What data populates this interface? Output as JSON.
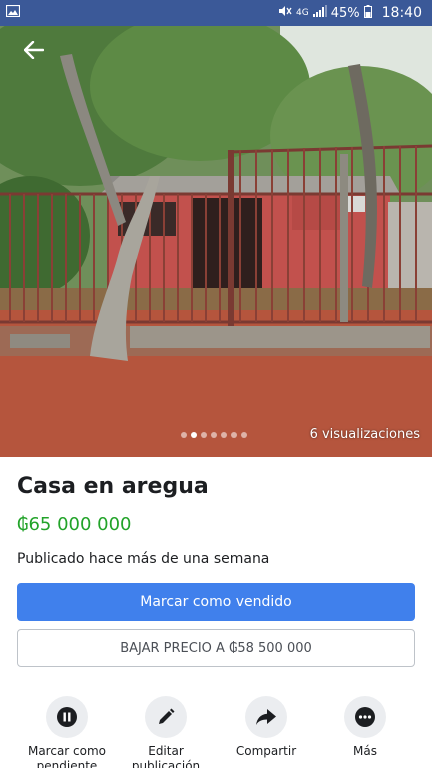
{
  "status_bar": {
    "signal_label": "4G",
    "battery": "45%",
    "time": "18:40"
  },
  "listing": {
    "image_views": "6 visualizaciones",
    "image_count": 7,
    "active_image_index": 1,
    "title": "Casa en aregua",
    "price": "₲65 000 000",
    "posted": "Publicado hace más de una semana"
  },
  "buttons": {
    "mark_sold": "Marcar como vendido",
    "lower_price": "BAJAR PRECIO A ₲58 500 000"
  },
  "actions": [
    {
      "label": "Marcar como pendiente",
      "icon": "pause-icon"
    },
    {
      "label": "Editar publicación",
      "icon": "pencil-icon"
    },
    {
      "label": "Compartir",
      "icon": "share-icon"
    },
    {
      "label": "Más",
      "icon": "more-icon"
    }
  ],
  "colors": {
    "status_bar": "#3b5998",
    "primary_button": "#4080ec",
    "price": "#22a329"
  }
}
